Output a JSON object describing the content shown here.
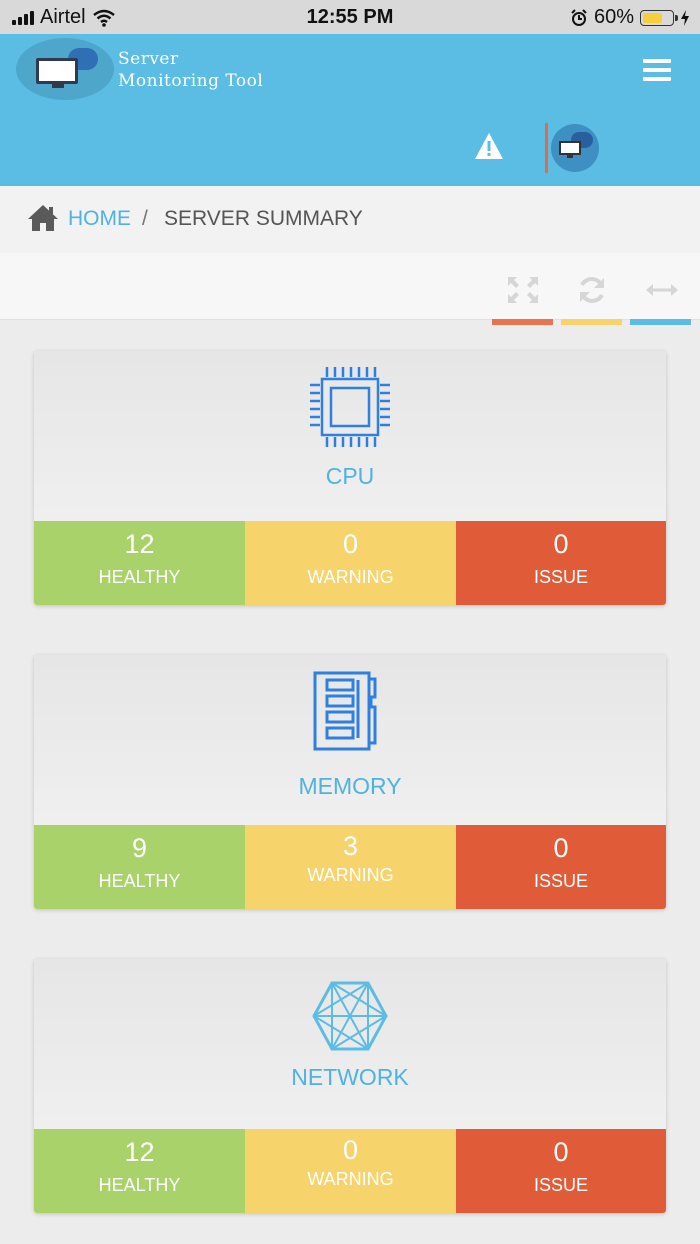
{
  "status_bar": {
    "carrier": "Airtel",
    "time": "12:55 PM",
    "battery": "60%"
  },
  "header": {
    "title_line1": "Server",
    "title_line2": "Monitoring Tool"
  },
  "breadcrumb": {
    "home": "HOME",
    "separator": "/",
    "current": "SERVER SUMMARY"
  },
  "toolbar_colors": {
    "red": "#e8734f",
    "yellow": "#f7d36b",
    "blue": "#5bbce4"
  },
  "cards": [
    {
      "title": "CPU",
      "icon": "cpu-icon",
      "healthy": "12",
      "healthy_label": "HEALTHY",
      "warning": "0",
      "warning_label": "WARNING",
      "issue": "0",
      "issue_label": "ISSUE"
    },
    {
      "title": "MEMORY",
      "icon": "memory-icon",
      "healthy": "9",
      "healthy_label": "HEALTHY",
      "warning": "3",
      "warning_label": "WARNING",
      "issue": "0",
      "issue_label": "ISSUE"
    },
    {
      "title": "NETWORK",
      "icon": "network-icon",
      "healthy": "12",
      "healthy_label": "HEALTHY",
      "warning": "0",
      "warning_label": "WARNING",
      "issue": "0",
      "issue_label": "ISSUE"
    }
  ]
}
